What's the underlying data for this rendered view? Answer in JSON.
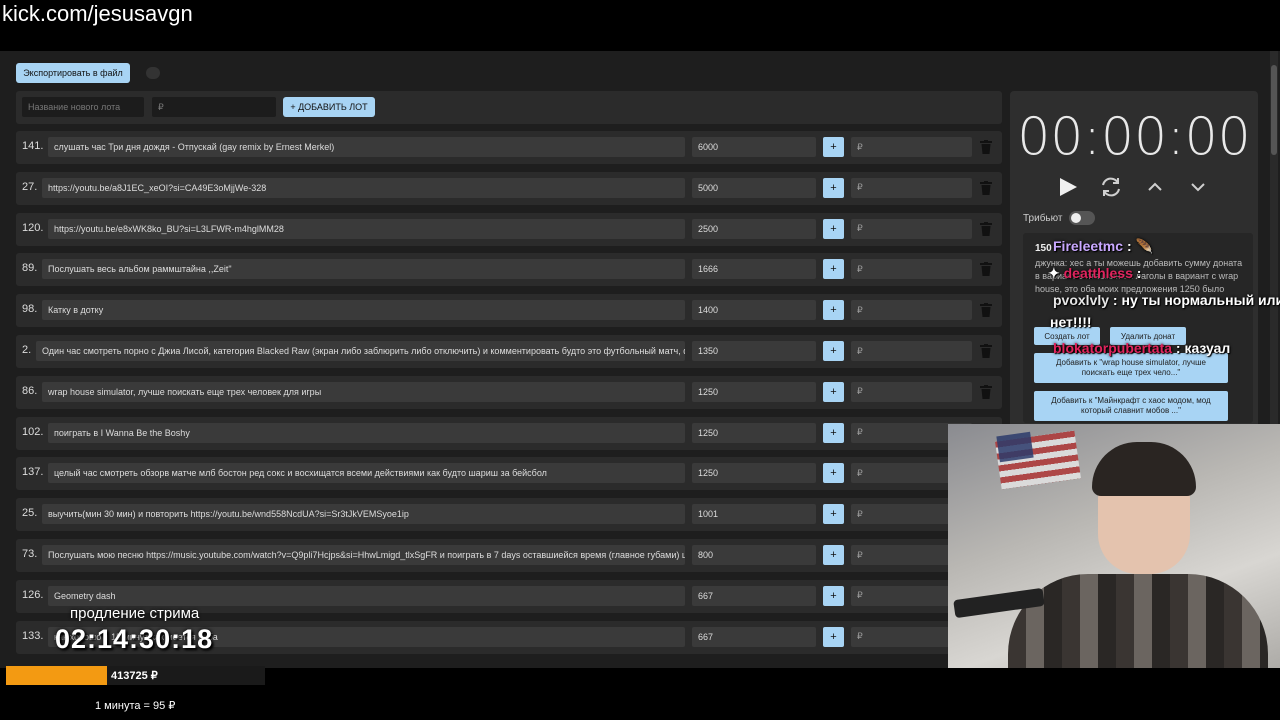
{
  "stream_url": "kick.com/jesusavgn",
  "toolbar": {
    "export_label": "Экспортировать в файл"
  },
  "new_lot": {
    "name_placeholder": "Название нового лота",
    "price_placeholder": "₽",
    "add_label": "+ ДОБАВИТЬ ЛОТ"
  },
  "lots": [
    {
      "num": "141.",
      "title": "слушать час Три дня дождя - Отпускай (gay remix by Ernest Merkel)",
      "amount": "6000",
      "plus": "+",
      "addon_placeholder": "₽"
    },
    {
      "num": "27.",
      "title": "https://youtu.be/a8J1EC_xeOI?si=CA49E3oMjjWe-328",
      "amount": "5000",
      "plus": "+",
      "addon_placeholder": "₽"
    },
    {
      "num": "120.",
      "title": "https://youtu.be/e8xWK8ko_BU?si=L3LFWR-m4hglMM28",
      "amount": "2500",
      "plus": "+",
      "addon_placeholder": "₽"
    },
    {
      "num": "89.",
      "title": "Послушать весь альбом раммштайна ,,Zeit\"",
      "amount": "1666",
      "plus": "+",
      "addon_placeholder": "₽"
    },
    {
      "num": "98.",
      "title": "Катку в дотку",
      "amount": "1400",
      "plus": "+",
      "addon_placeholder": "₽"
    },
    {
      "num": "2.",
      "title": "Один час смотреть порно с Джиа Лисой, категория Blacked Raw (экран либо заблюрить либо отключить) и комментировать будто это футбольный матч, ф",
      "amount": "1350",
      "plus": "+",
      "addon_placeholder": "₽"
    },
    {
      "num": "86.",
      "title": "wrap house simulator, лучше поискать еще трех человек для игры",
      "amount": "1250",
      "plus": "+",
      "addon_placeholder": "₽"
    },
    {
      "num": "102.",
      "title": "поиграть в I Wanna Be the Boshy",
      "amount": "1250",
      "plus": "+",
      "addon_placeholder": "₽"
    },
    {
      "num": "137.",
      "title": "целый час смотреть обзорв матче млб бостон ред сокс и восхищатся всеми действиями как будто шариш за бейсбол",
      "amount": "1250",
      "plus": "+",
      "addon_placeholder": "₽"
    },
    {
      "num": "25.",
      "title": "выучить(мин 30 мин) и повторить https://youtu.be/wnd558NcdUA?si=Sr3tJkVEMSyoe1ip",
      "amount": "1001",
      "plus": "+",
      "addon_placeholder": "₽"
    },
    {
      "num": "73.",
      "title": "Послушать мою песню https://music.youtube.com/watch?v=Q9pli7Hcjps&si=HhwLmigd_tlxSgFR и поиграть в 7 days оставшиейся время (главное губами) ш",
      "amount": "800",
      "plus": "+",
      "addon_placeholder": "₽"
    },
    {
      "num": "126.",
      "title": "Geometry dash",
      "amount": "667",
      "plus": "+",
      "addon_placeholder": "₽"
    },
    {
      "num": "133.",
      "title": "как хорошо я 15 минут как моется буба",
      "amount": "667",
      "plus": "+",
      "addon_placeholder": "₽"
    }
  ],
  "timer": {
    "display": "00:00:00"
  },
  "tribute": {
    "label": "Трибьют"
  },
  "donation": {
    "amount": "150",
    "text": "джункa: хес а ты можешь добавить сумму донатa в вариант с пташкина и лаголы в вариант с wrap house, это оба моих предложения 1250 было",
    "create_label": "Создать лот",
    "delete_label": "Удалить донат",
    "add_to_1": "Добавить к \"wrap house simulator, лучше поискать еще трех чело...\"",
    "add_to_2": "Добавить к \"Майнкрафт с хаос модом, мод который славнит мобов ...\""
  },
  "chat": [
    {
      "user": "Fireleetmc",
      "sep": ":",
      "message": ""
    },
    {
      "user": "deatthless",
      "sep": ":",
      "message": ""
    },
    {
      "user": "pvoxlvly",
      "sep": ":",
      "message": "ну ты нормальный или"
    },
    {
      "user": "",
      "sep": "",
      "message": "нет!!!!"
    },
    {
      "user": "blokatorpubertata",
      "sep": ":",
      "message": "казуал"
    }
  ],
  "extension": {
    "label": "продление стрима",
    "time": "02:14:30:18"
  },
  "progress": {
    "sum": "413725 ₽",
    "fill_fraction": 0.39
  },
  "rate": {
    "text": "1 минута = 95 ₽"
  },
  "colors": {
    "accent": "#a8d4f4",
    "progress": "#f39a12",
    "panel": "#2b2b2b"
  }
}
